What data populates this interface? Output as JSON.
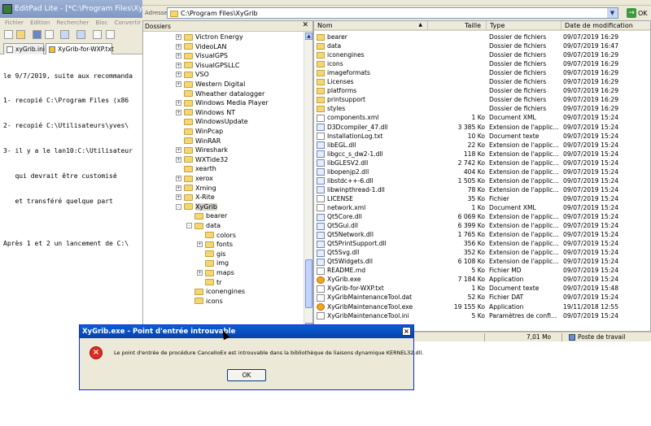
{
  "editpad": {
    "title": "EditPad Lite - [*C:\\Program Files\\XyGrib",
    "menu": [
      "Fichier",
      "Edition",
      "Rechercher",
      "Bloc",
      "Convertir",
      "O"
    ],
    "tabs": [
      "xyGrib.ini",
      "XyGrib-for-WXP.txt"
    ],
    "lines": [
      "le 9/7/2019, suite aux recommanda",
      "1- recopié C:\\Program Files (x86",
      "2- recopié C:\\Utilisateurs\\yves\\",
      "3- il y a le lan10:C:\\Utilisateur",
      "   qui devrait être customisé",
      "   et transféré quelque part",
      "",
      "Après 1 et 2 un lancement de C:\\"
    ]
  },
  "explorer": {
    "address_label": "Adresse",
    "address": "C:\\Program Files\\XyGrib",
    "go_label": "OK",
    "folders_header": "Dossiers",
    "tree": [
      {
        "label": "Victron Energy",
        "exp": "+",
        "level": 0
      },
      {
        "label": "VideoLAN",
        "exp": "+",
        "level": 0
      },
      {
        "label": "VisualGPS",
        "exp": "+",
        "level": 0
      },
      {
        "label": "VisualGPSLLC",
        "exp": "+",
        "level": 0
      },
      {
        "label": "VSO",
        "exp": "+",
        "level": 0
      },
      {
        "label": "Western Digital",
        "exp": "+",
        "level": 0
      },
      {
        "label": "Wheather datalogger",
        "exp": "",
        "level": 0
      },
      {
        "label": "Windows Media Player",
        "exp": "+",
        "level": 0
      },
      {
        "label": "Windows NT",
        "exp": "+",
        "level": 0
      },
      {
        "label": "WindowsUpdate",
        "exp": "",
        "level": 0
      },
      {
        "label": "WinPcap",
        "exp": "",
        "level": 0
      },
      {
        "label": "WinRAR",
        "exp": "",
        "level": 0
      },
      {
        "label": "Wireshark",
        "exp": "+",
        "level": 0
      },
      {
        "label": "WXTide32",
        "exp": "+",
        "level": 0
      },
      {
        "label": "xearth",
        "exp": "",
        "level": 0
      },
      {
        "label": "xerox",
        "exp": "+",
        "level": 0
      },
      {
        "label": "Xming",
        "exp": "+",
        "level": 0
      },
      {
        "label": "X-Rite",
        "exp": "+",
        "level": 0
      },
      {
        "label": "XyGrib",
        "exp": "-",
        "level": 0,
        "selected": true
      },
      {
        "label": "bearer",
        "exp": "",
        "level": 1
      },
      {
        "label": "data",
        "exp": "-",
        "level": 1
      },
      {
        "label": "colors",
        "exp": "",
        "level": 2
      },
      {
        "label": "fonts",
        "exp": "+",
        "level": 2
      },
      {
        "label": "gis",
        "exp": "",
        "level": 2
      },
      {
        "label": "img",
        "exp": "",
        "level": 2
      },
      {
        "label": "maps",
        "exp": "+",
        "level": 2
      },
      {
        "label": "tr",
        "exp": "",
        "level": 2
      },
      {
        "label": "iconengines",
        "exp": "",
        "level": 1
      },
      {
        "label": "icons",
        "exp": "",
        "level": 1
      }
    ],
    "columns": [
      "Nom",
      "Taille",
      "Type",
      "Date de modification"
    ],
    "sort_indicator": "▲",
    "files": [
      {
        "name": "bearer",
        "size": "",
        "type": "Dossier de fichiers",
        "date": "09/07/2019 16:29",
        "icon": "folder"
      },
      {
        "name": "data",
        "size": "",
        "type": "Dossier de fichiers",
        "date": "09/07/2019 16:47",
        "icon": "folder"
      },
      {
        "name": "iconengines",
        "size": "",
        "type": "Dossier de fichiers",
        "date": "09/07/2019 16:29",
        "icon": "folder"
      },
      {
        "name": "icons",
        "size": "",
        "type": "Dossier de fichiers",
        "date": "09/07/2019 16:29",
        "icon": "folder"
      },
      {
        "name": "imageformats",
        "size": "",
        "type": "Dossier de fichiers",
        "date": "09/07/2019 16:29",
        "icon": "folder"
      },
      {
        "name": "Licenses",
        "size": "",
        "type": "Dossier de fichiers",
        "date": "09/07/2019 16:29",
        "icon": "folder"
      },
      {
        "name": "platforms",
        "size": "",
        "type": "Dossier de fichiers",
        "date": "09/07/2019 16:29",
        "icon": "folder"
      },
      {
        "name": "printsupport",
        "size": "",
        "type": "Dossier de fichiers",
        "date": "09/07/2019 16:29",
        "icon": "folder"
      },
      {
        "name": "styles",
        "size": "",
        "type": "Dossier de fichiers",
        "date": "09/07/2019 16:29",
        "icon": "folder"
      },
      {
        "name": "components.xml",
        "size": "1 Ko",
        "type": "Document XML",
        "date": "09/07/2019 15:24",
        "icon": "file"
      },
      {
        "name": "D3Dcompiler_47.dll",
        "size": "3 385 Ko",
        "type": "Extension de l'applic...",
        "date": "09/07/2019 15:24",
        "icon": "dll"
      },
      {
        "name": "InstallationLog.txt",
        "size": "10 Ko",
        "type": "Document texte",
        "date": "09/07/2019 15:24",
        "icon": "file"
      },
      {
        "name": "libEGL.dll",
        "size": "22 Ko",
        "type": "Extension de l'applic...",
        "date": "09/07/2019 15:24",
        "icon": "dll"
      },
      {
        "name": "libgcc_s_dw2-1.dll",
        "size": "118 Ko",
        "type": "Extension de l'applic...",
        "date": "09/07/2019 15:24",
        "icon": "dll"
      },
      {
        "name": "libGLESV2.dll",
        "size": "2 742 Ko",
        "type": "Extension de l'applic...",
        "date": "09/07/2019 15:24",
        "icon": "dll"
      },
      {
        "name": "libopenjp2.dll",
        "size": "404 Ko",
        "type": "Extension de l'applic...",
        "date": "09/07/2019 15:24",
        "icon": "dll"
      },
      {
        "name": "libstdc++-6.dll",
        "size": "1 505 Ko",
        "type": "Extension de l'applic...",
        "date": "09/07/2019 15:24",
        "icon": "dll"
      },
      {
        "name": "libwinpthread-1.dll",
        "size": "78 Ko",
        "type": "Extension de l'applic...",
        "date": "09/07/2019 15:24",
        "icon": "dll"
      },
      {
        "name": "LICENSE",
        "size": "35 Ko",
        "type": "Fichier",
        "date": "09/07/2019 15:24",
        "icon": "file"
      },
      {
        "name": "network.xml",
        "size": "1 Ko",
        "type": "Document XML",
        "date": "09/07/2019 15:24",
        "icon": "file"
      },
      {
        "name": "Qt5Core.dll",
        "size": "6 069 Ko",
        "type": "Extension de l'applic...",
        "date": "09/07/2019 15:24",
        "icon": "dll"
      },
      {
        "name": "Qt5Gui.dll",
        "size": "6 399 Ko",
        "type": "Extension de l'applic...",
        "date": "09/07/2019 15:24",
        "icon": "dll"
      },
      {
        "name": "Qt5Network.dll",
        "size": "1 765 Ko",
        "type": "Extension de l'applic...",
        "date": "09/07/2019 15:24",
        "icon": "dll"
      },
      {
        "name": "Qt5PrintSupport.dll",
        "size": "356 Ko",
        "type": "Extension de l'applic...",
        "date": "09/07/2019 15:24",
        "icon": "dll"
      },
      {
        "name": "Qt5Svg.dll",
        "size": "352 Ko",
        "type": "Extension de l'applic...",
        "date": "09/07/2019 15:24",
        "icon": "dll"
      },
      {
        "name": "Qt5Widgets.dll",
        "size": "6 108 Ko",
        "type": "Extension de l'applic...",
        "date": "09/07/2019 15:24",
        "icon": "dll"
      },
      {
        "name": "README.md",
        "size": "5 Ko",
        "type": "Fichier MD",
        "date": "09/07/2019 15:24",
        "icon": "file"
      },
      {
        "name": "XyGrib.exe",
        "size": "7 184 Ko",
        "type": "Application",
        "date": "09/07/2019 15:24",
        "icon": "exe"
      },
      {
        "name": "XyGrib-for-WXP.txt",
        "size": "1 Ko",
        "type": "Document texte",
        "date": "09/07/2019 15:48",
        "icon": "file"
      },
      {
        "name": "XyGribMaintenanceTool.dat",
        "size": "52 Ko",
        "type": "Fichier DAT",
        "date": "09/07/2019 15:24",
        "icon": "file"
      },
      {
        "name": "XyGribMaintenanceTool.exe",
        "size": "19 155 Ko",
        "type": "Application",
        "date": "19/11/2018 12:55",
        "icon": "exe"
      },
      {
        "name": "XyGribMaintenanceTool.ini",
        "size": "5 Ko",
        "type": "Paramètres de confi...",
        "date": "09/07/2019 15:24",
        "icon": "file"
      }
    ],
    "status_size": "7,01 Mo",
    "status_location": "Poste de travail"
  },
  "dialog": {
    "title": "XyGrib.exe - Point d'entrée introuvable",
    "message": "Le point d'entrée de procédure CancelIoEx est introuvable dans la bibliothèque de liaisons dynamique KERNEL32.dll.",
    "ok_label": "OK",
    "close_glyph": "×",
    "error_glyph": "×"
  }
}
